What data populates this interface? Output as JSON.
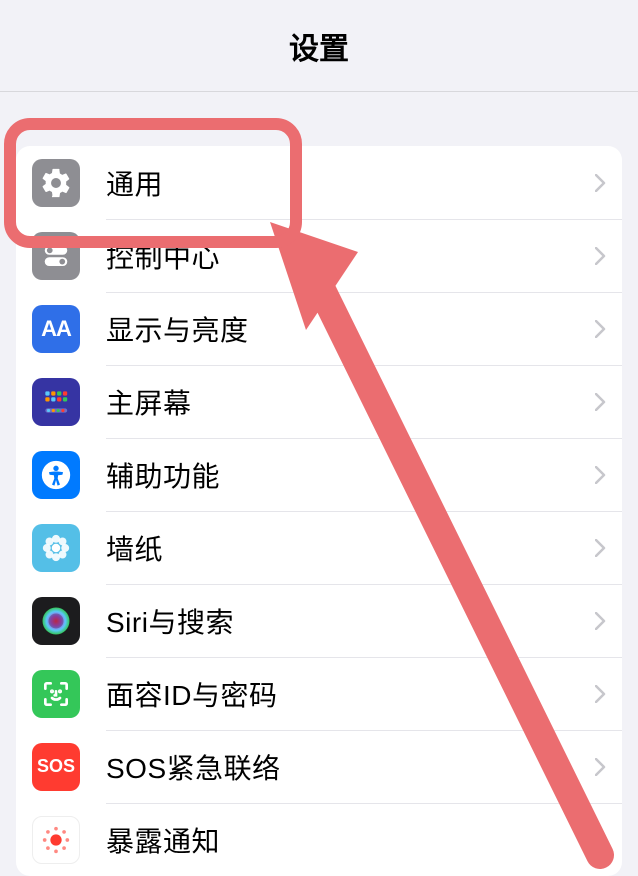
{
  "header": {
    "title": "设置"
  },
  "rows": [
    {
      "id": "general",
      "label": "通用",
      "icon": "gear",
      "bg": "#8e8e93"
    },
    {
      "id": "control-center",
      "label": "控制中心",
      "icon": "toggles",
      "bg": "#8e8e93"
    },
    {
      "id": "display",
      "label": "显示与亮度",
      "icon": "aa",
      "bg": "#2f6fe8"
    },
    {
      "id": "home-screen",
      "label": "主屏幕",
      "icon": "grid",
      "bg": "#3a3a9e"
    },
    {
      "id": "accessibility",
      "label": "辅助功能",
      "icon": "person",
      "bg": "#007aff"
    },
    {
      "id": "wallpaper",
      "label": "墙纸",
      "icon": "flower",
      "bg": "#54bfe7"
    },
    {
      "id": "siri",
      "label": "Siri与搜索",
      "icon": "siri",
      "bg": "#1c1c1e"
    },
    {
      "id": "faceid",
      "label": "面容ID与密码",
      "icon": "faceid",
      "bg": "#34c759"
    },
    {
      "id": "sos",
      "label": "SOS紧急联络",
      "icon": "sos",
      "bg": "#ff3b30"
    },
    {
      "id": "exposure",
      "label": "暴露通知",
      "icon": "exposure",
      "bg": "#ffffff"
    }
  ],
  "annotation": {
    "highlight_row_index": 0,
    "arrow_color": "#eb6d70"
  }
}
